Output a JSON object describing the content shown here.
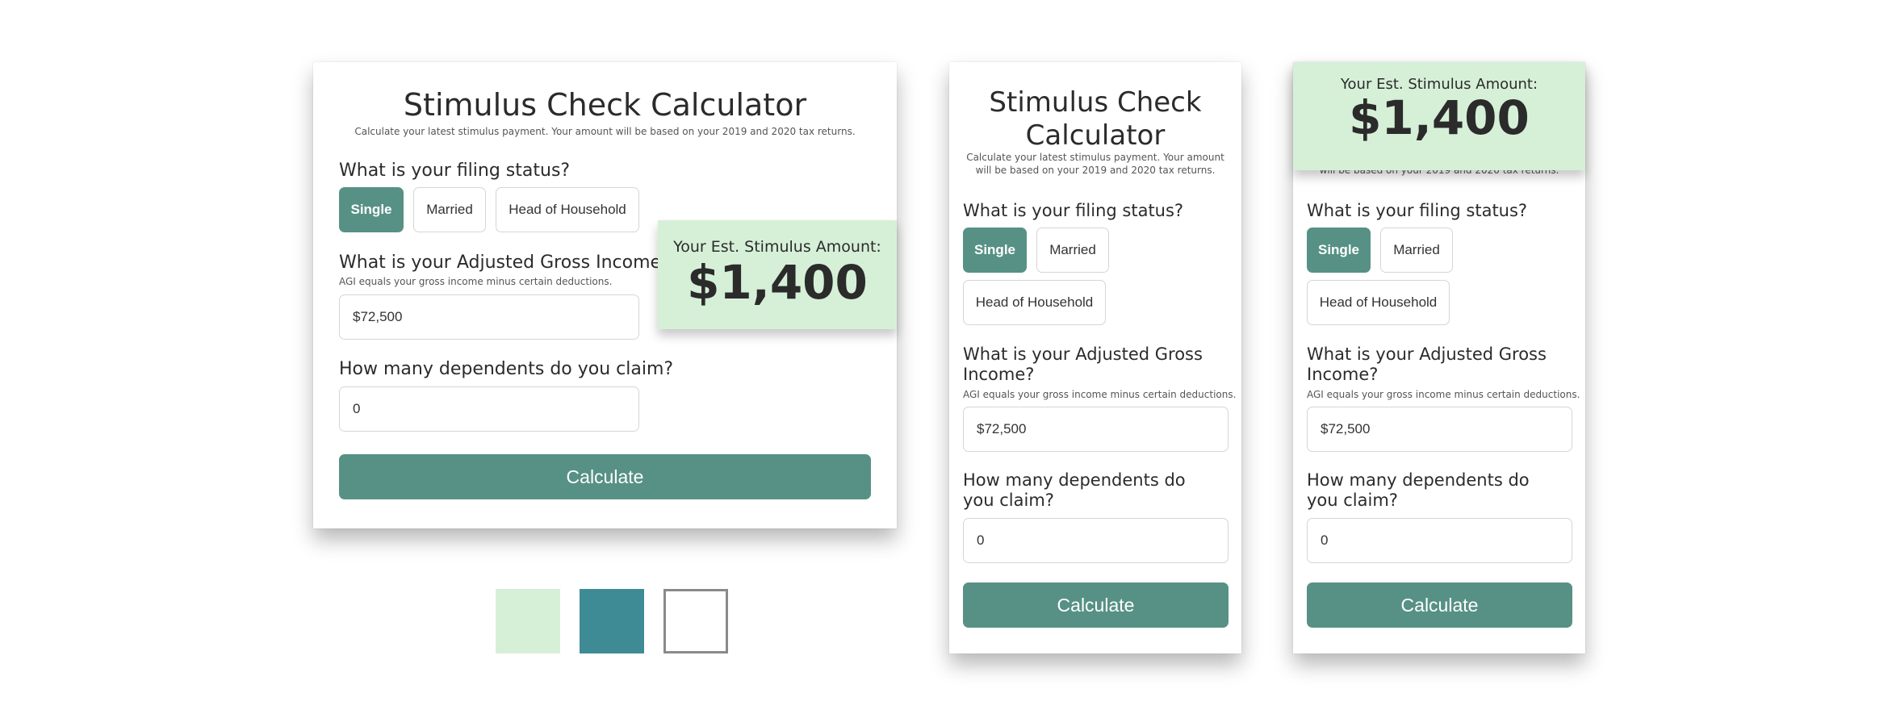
{
  "title": "Stimulus Check Calculator",
  "subtitle": "Calculate your latest stimulus payment. Your amount will be based on your 2019 and 2020 tax returns.",
  "filing_status": {
    "question": "What is your filing status?",
    "options": [
      "Single",
      "Married",
      "Head of Household"
    ],
    "selected": "Single"
  },
  "agi": {
    "question": "What is your Adjusted Gross Income?",
    "helper": "AGI equals your gross income minus certain deductions.",
    "value": "$72,500"
  },
  "dependents": {
    "question": "How many dependents do you claim?",
    "value": "0"
  },
  "calculate_label": "Calculate",
  "result": {
    "label": "Your Est. Stimulus Amount:",
    "amount": "$1,400"
  },
  "colors": {
    "light_green": "#d6f0d8",
    "teal": "#3f8b95",
    "white": "#ffffff",
    "button_green": "#579185"
  }
}
